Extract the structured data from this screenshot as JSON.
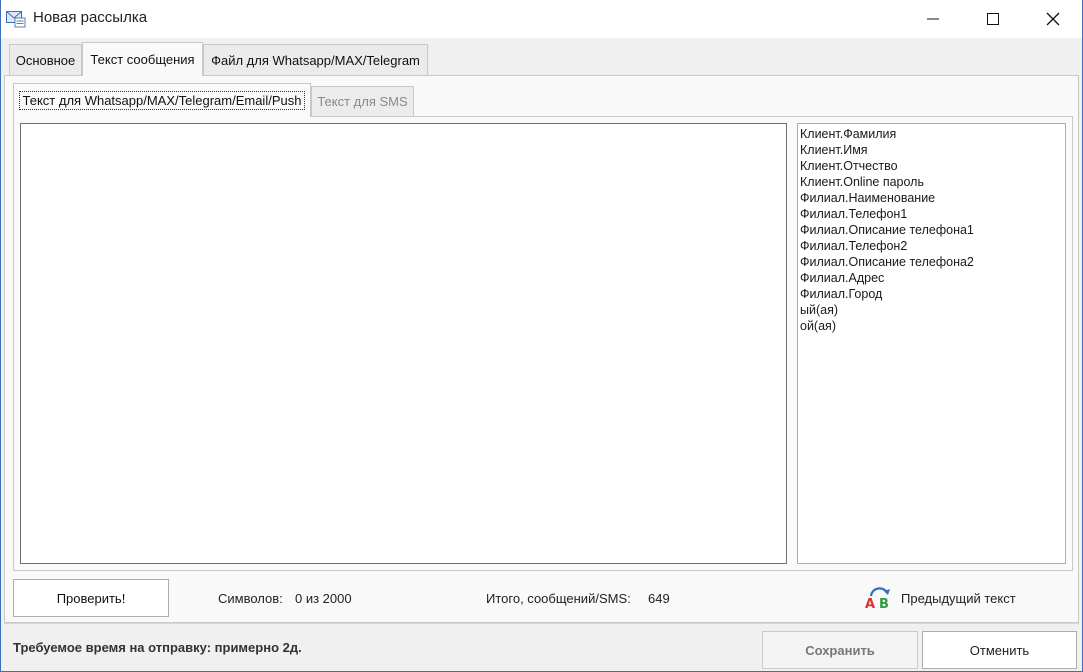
{
  "window": {
    "title": "Новая рассылка"
  },
  "tabs": [
    {
      "label": "Основное"
    },
    {
      "label": "Текст сообщения"
    },
    {
      "label": "Файл для Whatsapp/MAX/Telegram"
    }
  ],
  "subtabs": [
    {
      "label": "Текст для Whatsapp/MAX/Telegram/Email/Push"
    },
    {
      "label": "Текст для SMS"
    }
  ],
  "editor": {
    "value": ""
  },
  "variables": [
    "Клиент.Фамилия",
    "Клиент.Имя",
    "Клиент.Отчество",
    "Клиент.Online пароль",
    "Филиал.Наименование",
    "Филиал.Телефон1",
    "Филиал.Описание телефона1",
    "Филиал.Телефон2",
    "Филиал.Описание телефона2",
    "Филиал.Адрес",
    "Филиал.Город",
    "ый(ая)",
    "ой(ая)"
  ],
  "footer": {
    "check_button": "Проверить!",
    "chars_label": "Символов:",
    "chars_value": "0 из 2000",
    "total_label": "Итого, сообщений/SMS:",
    "total_value": "649",
    "prev_text": "Предыдущий текст",
    "required_time": "Требуемое время на отправку: примерно 2д.",
    "save_button": "Сохранить",
    "cancel_button": "Отменить"
  },
  "colors": {
    "accent": "#3c6fb8",
    "prev_icon_a": "#e03030",
    "prev_icon_b": "#2e9e3e",
    "prev_icon_arrow": "#2f6fc0"
  }
}
